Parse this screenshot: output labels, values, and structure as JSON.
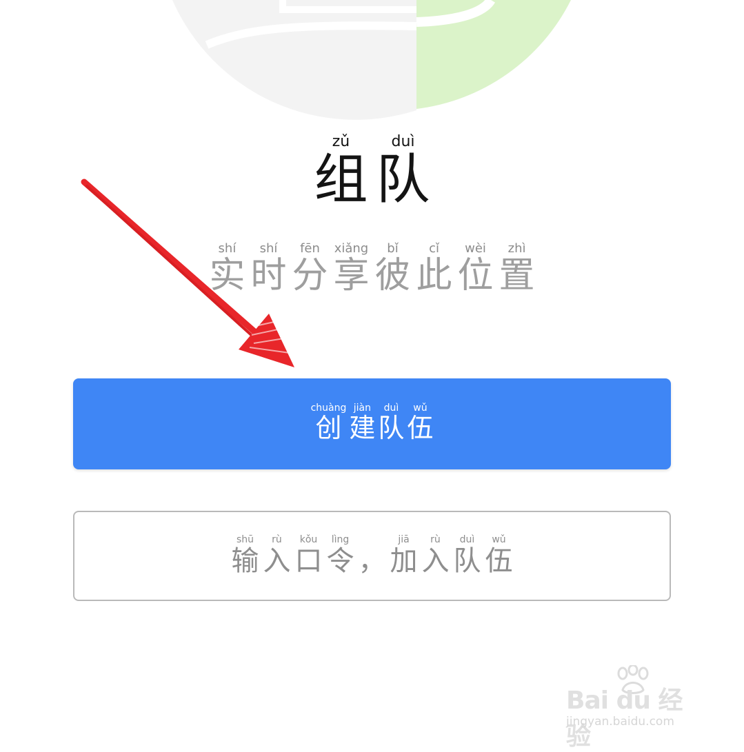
{
  "title": {
    "chars": [
      "组",
      "队"
    ],
    "pinyin": [
      "zǔ",
      "duì"
    ]
  },
  "subtitle": {
    "chars": [
      "实",
      "时",
      "分",
      "享",
      "彼",
      "此",
      "位",
      "置"
    ],
    "pinyin": [
      "shí",
      "shí",
      "fēn",
      "xiǎng",
      "bǐ",
      "cǐ",
      "wèi",
      "zhì"
    ]
  },
  "create_button": {
    "chars": [
      "创",
      "建",
      "队",
      "伍"
    ],
    "pinyin": [
      "chuàng",
      "jiàn",
      "duì",
      "wǔ"
    ]
  },
  "join_button": {
    "chars": [
      "输",
      "入",
      "口",
      "令",
      "，",
      "加",
      "入",
      "队",
      "伍"
    ],
    "pinyin": [
      "shū",
      "rù",
      "kǒu",
      "lìng",
      "",
      "jiā",
      "rù",
      "duì",
      "wǔ"
    ]
  },
  "watermark": {
    "brand": "Bai du 经验",
    "url": "jingyan.baidu.com"
  },
  "icons": {
    "logo": "team-logo-icon",
    "arrow": "annotation-arrow-icon",
    "paw": "baidu-paw-icon"
  },
  "colors": {
    "primary": "#3f86f5",
    "annotation": "#e8262a",
    "logo_gray": "#f3f3f3",
    "logo_green": "#dbf3c9"
  }
}
